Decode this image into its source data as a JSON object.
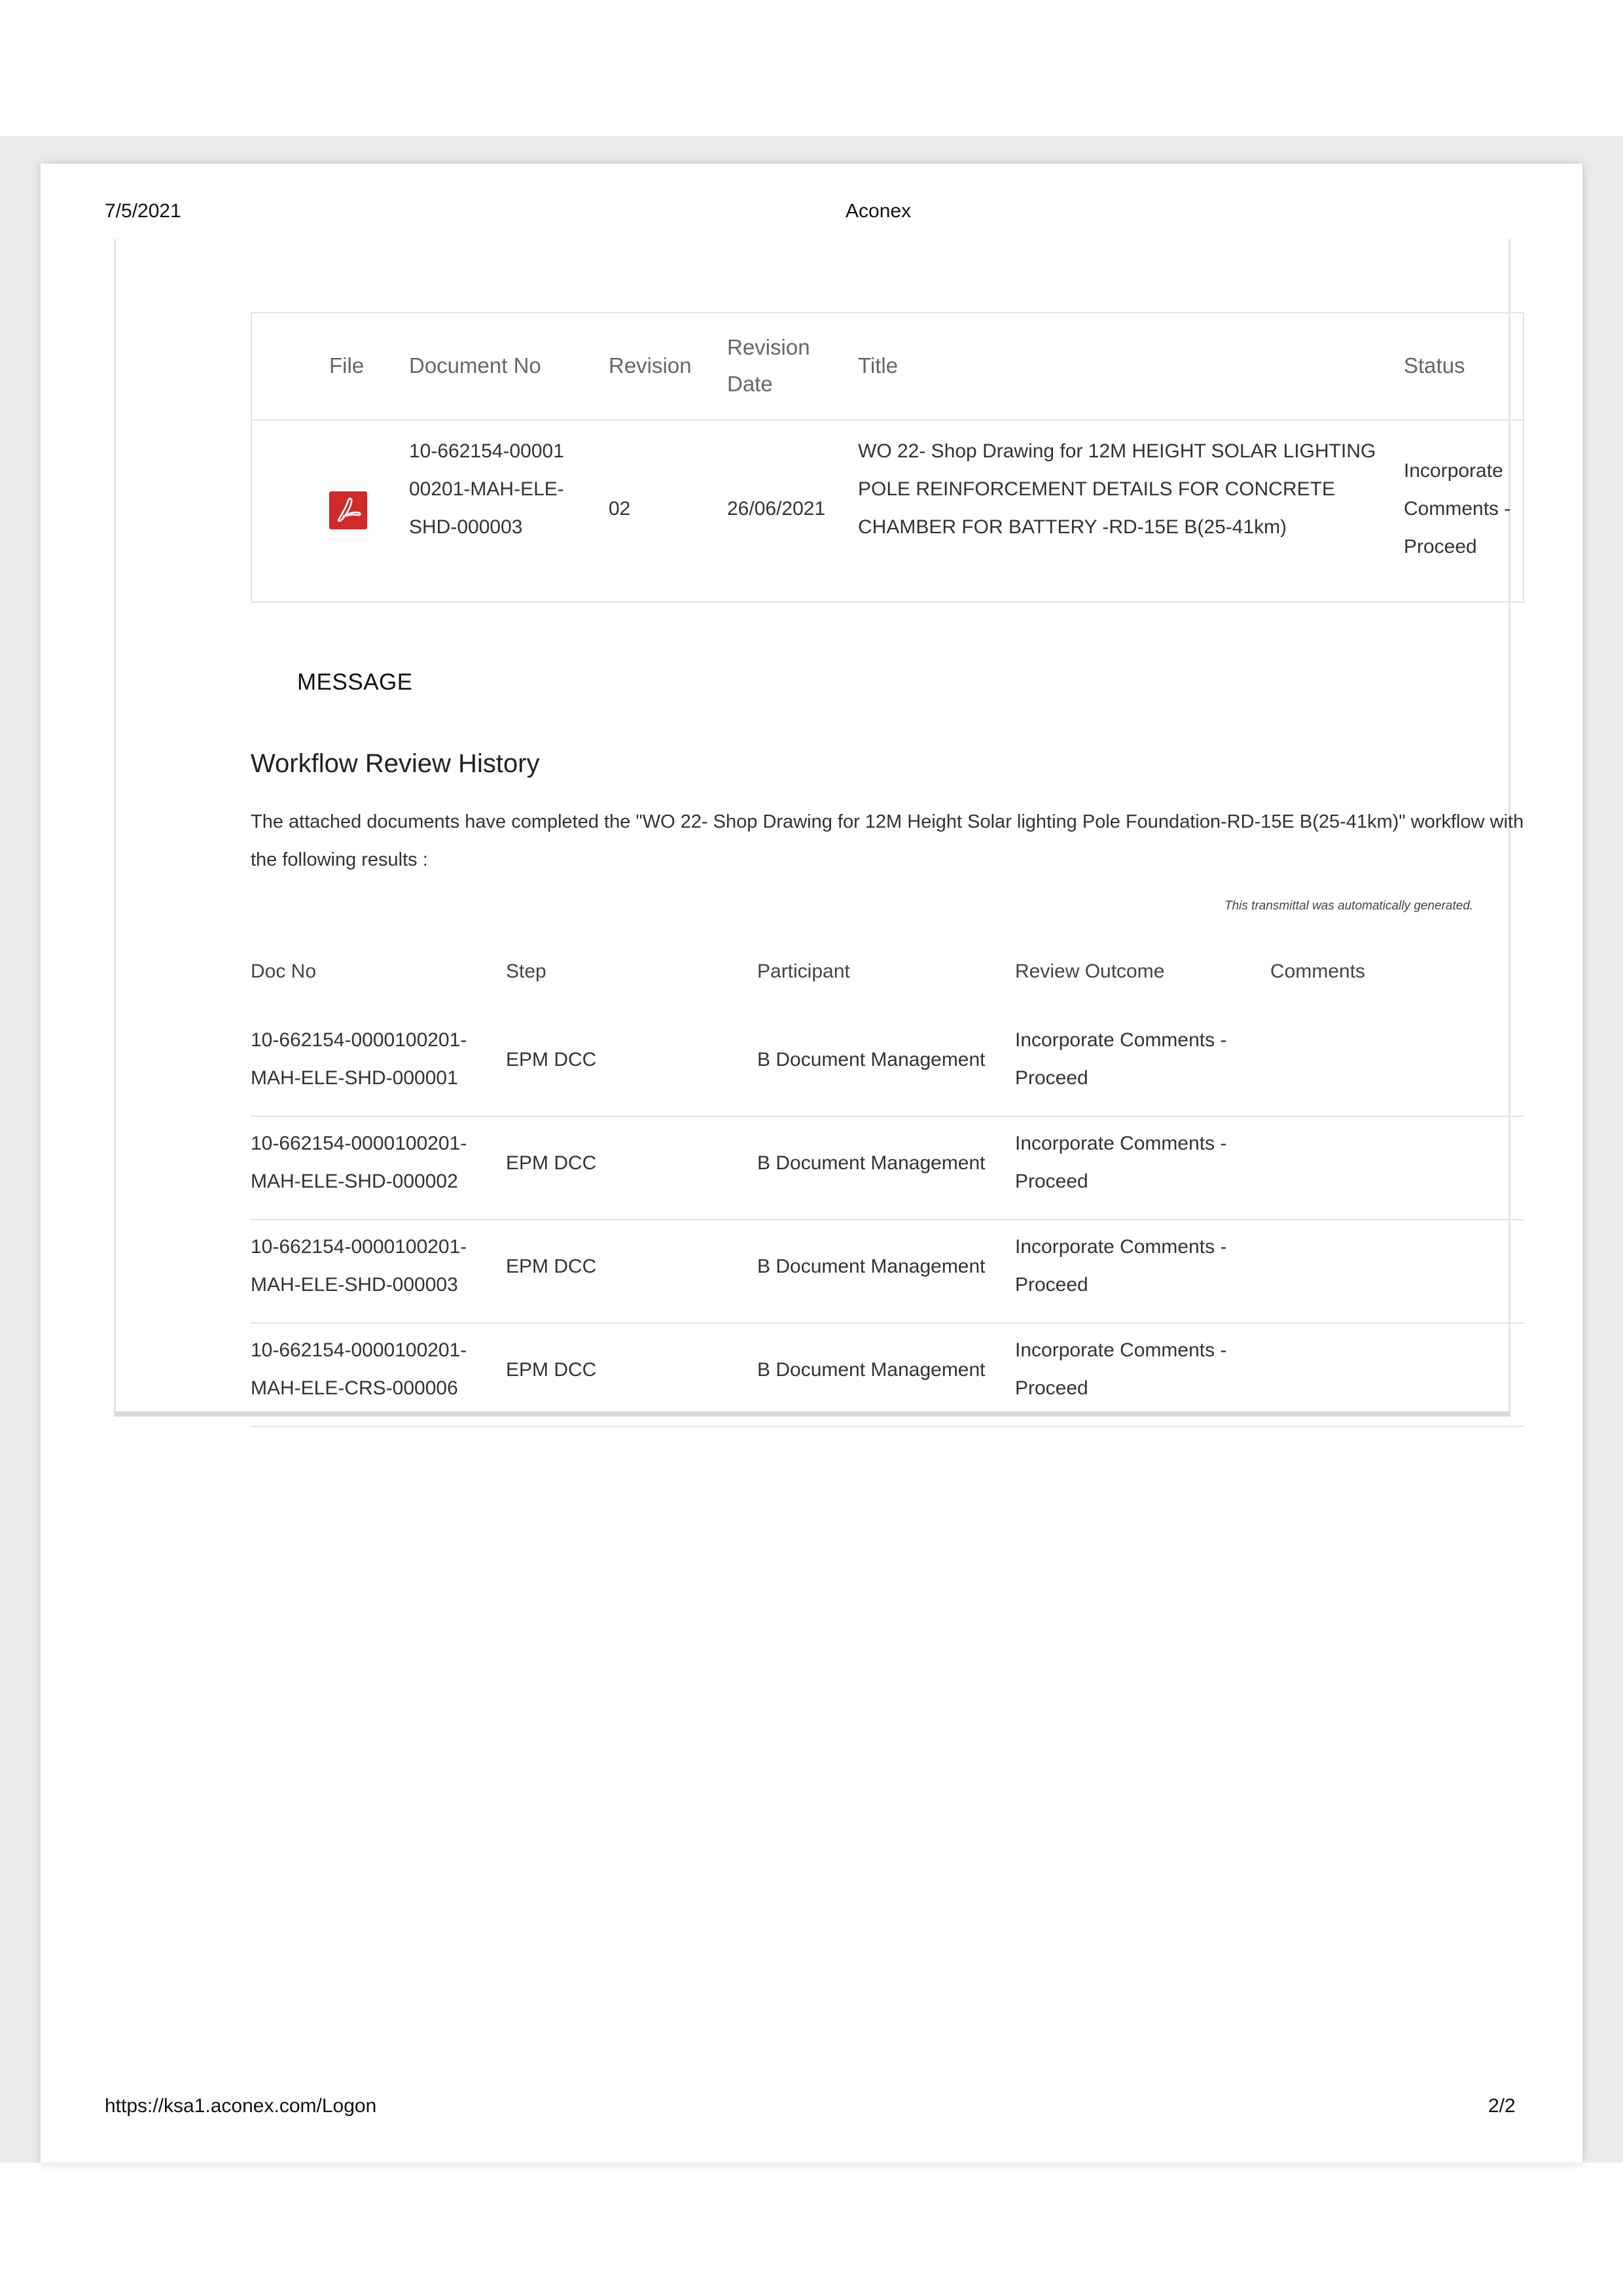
{
  "header": {
    "date": "7/5/2021",
    "app_name": "Aconex"
  },
  "footer": {
    "url": "https://ksa1.aconex.com/Logon",
    "page": "2/2"
  },
  "documents_table": {
    "columns": [
      "File",
      "Document No",
      "Revision",
      "Revision Date",
      "Title",
      "Status"
    ],
    "rows": [
      {
        "file_icon": "pdf-icon",
        "document_no": "10-662154-0000100201-MAH-ELE-SHD-000003",
        "revision": "02",
        "revision_date": "26/06/2021",
        "title": "WO 22- Shop Drawing for 12M HEIGHT SOLAR LIGHTING POLE REINFORCEMENT DETAILS FOR CONCRETE CHAMBER FOR BATTERY -RD-15E B(25-41km)",
        "status": "Incorporate Comments - Proceed"
      }
    ]
  },
  "message": {
    "label": "MESSAGE",
    "workflow_title": "Workflow Review History",
    "description": "The attached documents have completed the \"WO 22- Shop Drawing for 12M Height Solar lighting Pole Foundation-RD-15E B(25-41km)\" workflow with the following results :",
    "auto_note": "This transmittal was automatically generated."
  },
  "review_table": {
    "columns": [
      "Doc No",
      "Step",
      "Participant",
      "Review Outcome",
      "Comments"
    ],
    "rows": [
      {
        "doc_no": "10-662154-0000100201-MAH-ELE-SHD-000001",
        "step": "EPM DCC",
        "participant": "B Document Management",
        "outcome": "Incorporate Comments - Proceed",
        "comments": ""
      },
      {
        "doc_no": "10-662154-0000100201-MAH-ELE-SHD-000002",
        "step": "EPM DCC",
        "participant": "B Document Management",
        "outcome": "Incorporate Comments - Proceed",
        "comments": ""
      },
      {
        "doc_no": "10-662154-0000100201-MAH-ELE-SHD-000003",
        "step": "EPM DCC",
        "participant": "B Document Management",
        "outcome": "Incorporate Comments - Proceed",
        "comments": ""
      },
      {
        "doc_no": "10-662154-0000100201-MAH-ELE-CRS-000006",
        "step": "EPM DCC",
        "participant": "B Document Management",
        "outcome": "Incorporate Comments - Proceed",
        "comments": ""
      }
    ]
  },
  "colors": {
    "pdf_icon": "#d02a2a",
    "page_band": "#ececef"
  }
}
